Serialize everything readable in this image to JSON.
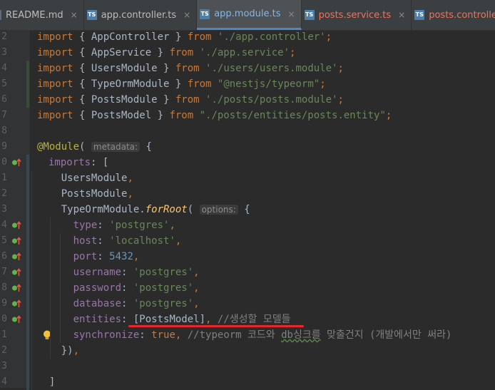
{
  "tabs": [
    {
      "label": "README.md",
      "icon": "md",
      "active": false,
      "error": false,
      "close": "×"
    },
    {
      "label": "app.controller.ts",
      "icon": "ts",
      "active": false,
      "error": false,
      "close": "×"
    },
    {
      "label": "app.module.ts",
      "icon": "ts",
      "active": true,
      "error": false,
      "close": "×"
    },
    {
      "label": "posts.service.ts",
      "icon": "ts",
      "active": false,
      "error": true,
      "close": "×"
    },
    {
      "label": "posts.controller.ts",
      "icon": "ts",
      "active": false,
      "error": true,
      "close": "×"
    },
    {
      "label": "pos",
      "icon": "ts",
      "active": false,
      "error": true,
      "close": ""
    }
  ],
  "editor": {
    "current_line_index": 23,
    "lines": [
      {
        "n": "2",
        "seg": [
          [
            "kw",
            "import"
          ],
          [
            "",
            " { AppController } "
          ],
          [
            "kw",
            "from"
          ],
          [
            "",
            " "
          ],
          [
            "str",
            "'./app.controller'"
          ],
          [
            "kw",
            ";"
          ]
        ]
      },
      {
        "n": "3",
        "seg": [
          [
            "kw",
            "import"
          ],
          [
            "",
            " { AppService } "
          ],
          [
            "kw",
            "from"
          ],
          [
            "",
            " "
          ],
          [
            "str",
            "'./app.service'"
          ],
          [
            "kw",
            ";"
          ]
        ]
      },
      {
        "n": "4",
        "seg": [
          [
            "kw",
            "import"
          ],
          [
            "",
            " { UsersModule } "
          ],
          [
            "kw",
            "from"
          ],
          [
            "",
            " "
          ],
          [
            "str",
            "'./users/users.module'"
          ],
          [
            "kw",
            ";"
          ]
        ]
      },
      {
        "n": "5",
        "seg": [
          [
            "kw",
            "import"
          ],
          [
            "",
            " { TypeOrmModule } "
          ],
          [
            "kw",
            "from"
          ],
          [
            "",
            " "
          ],
          [
            "str",
            "\"@nestjs/typeorm\""
          ],
          [
            "kw",
            ";"
          ]
        ]
      },
      {
        "n": "6",
        "seg": [
          [
            "kw",
            "import"
          ],
          [
            "",
            " { PostsModule } "
          ],
          [
            "kw",
            "from"
          ],
          [
            "",
            " "
          ],
          [
            "str",
            "'./posts/posts.module'"
          ],
          [
            "kw",
            ";"
          ]
        ]
      },
      {
        "n": "7",
        "seg": [
          [
            "kw",
            "import"
          ],
          [
            "",
            " { PostsModel } "
          ],
          [
            "kw",
            "from"
          ],
          [
            "",
            " "
          ],
          [
            "str",
            "\"./posts/entities/posts.entity\""
          ],
          [
            "kw",
            ";"
          ]
        ]
      },
      {
        "n": "8",
        "seg": []
      },
      {
        "n": "9",
        "seg": [
          [
            "ann",
            "@Module"
          ],
          [
            "",
            "( "
          ],
          [
            "hint",
            "metadata:"
          ],
          [
            "",
            " {"
          ]
        ]
      },
      {
        "n": "0",
        "seg": [
          [
            "",
            ""
          ],
          [
            "prop",
            "imports"
          ],
          [
            "",
            ": ["
          ]
        ]
      },
      {
        "n": "1",
        "seg": [
          [
            "",
            "    UsersModule"
          ],
          [
            "kw",
            ","
          ]
        ]
      },
      {
        "n": "2",
        "seg": [
          [
            "",
            "    PostsModule"
          ],
          [
            "kw",
            ","
          ]
        ]
      },
      {
        "n": "3",
        "seg": [
          [
            "",
            "    TypeOrmModule."
          ],
          [
            "fn",
            "forRoot"
          ],
          [
            "",
            "( "
          ],
          [
            "hint",
            "options:"
          ],
          [
            "",
            " {"
          ]
        ]
      },
      {
        "n": "4",
        "seg": [
          [
            "",
            "      "
          ],
          [
            "prop",
            "type"
          ],
          [
            "",
            ": "
          ],
          [
            "str",
            "'postgres'"
          ],
          [
            "kw",
            ","
          ]
        ]
      },
      {
        "n": "5",
        "seg": [
          [
            "",
            "      "
          ],
          [
            "prop",
            "host"
          ],
          [
            "",
            ": "
          ],
          [
            "str",
            "'localhost'"
          ],
          [
            "kw",
            ","
          ]
        ]
      },
      {
        "n": "6",
        "seg": [
          [
            "",
            "      "
          ],
          [
            "prop",
            "port"
          ],
          [
            "",
            ": "
          ],
          [
            "num",
            "5432"
          ],
          [
            "kw",
            ","
          ]
        ]
      },
      {
        "n": "7",
        "seg": [
          [
            "",
            "      "
          ],
          [
            "prop",
            "username"
          ],
          [
            "",
            ": "
          ],
          [
            "str",
            "'postgres'"
          ],
          [
            "kw",
            ","
          ]
        ]
      },
      {
        "n": "8",
        "seg": [
          [
            "",
            "      "
          ],
          [
            "prop",
            "password"
          ],
          [
            "",
            ": "
          ],
          [
            "str",
            "'postgres'"
          ],
          [
            "kw",
            ","
          ]
        ]
      },
      {
        "n": "9",
        "seg": [
          [
            "",
            "      "
          ],
          [
            "prop",
            "database"
          ],
          [
            "",
            ": "
          ],
          [
            "str",
            "'postgres'"
          ],
          [
            "kw",
            ","
          ]
        ]
      },
      {
        "n": "0",
        "seg": [
          [
            "",
            "      "
          ],
          [
            "prop",
            "entities"
          ],
          [
            "",
            ": [PostsModel]"
          ],
          [
            "kw",
            ","
          ],
          [
            "",
            " "
          ],
          [
            "cmt",
            "//생성할 모델들"
          ]
        ]
      },
      {
        "n": "1",
        "seg": [
          [
            "",
            "      "
          ],
          [
            "prop",
            "synchronize"
          ],
          [
            "",
            ": "
          ],
          [
            "kw",
            "true"
          ],
          [
            "kw",
            ","
          ],
          [
            "",
            " "
          ],
          [
            "cmt",
            "//typeorm 코드와 "
          ],
          [
            "cmtsq",
            "db싱크를"
          ],
          [
            "cmt",
            " 맞출건지 (개발에서만 써라)"
          ]
        ]
      },
      {
        "n": "2",
        "seg": [
          [
            "",
            "    })"
          ],
          [
            "kw",
            ","
          ]
        ]
      },
      {
        "n": "3",
        "seg": []
      },
      {
        "n": "4",
        "seg": [
          [
            "",
            "  ]"
          ]
        ]
      }
    ]
  },
  "line_numbers_shown": [
    "2",
    "3",
    "4",
    "5",
    "6",
    "7",
    "8",
    "9",
    "0",
    "1",
    "2",
    "3",
    "4",
    "5",
    "6",
    "7",
    "8",
    "9",
    "0",
    "1",
    "2",
    "3",
    "4"
  ]
}
